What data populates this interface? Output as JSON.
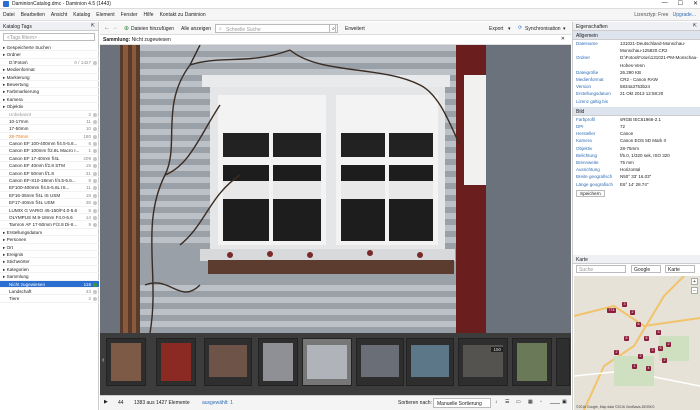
{
  "window": {
    "title": "DaminionCatalog.dmc - Daminion 4.5 (1443)",
    "controls": [
      "—",
      "☐",
      "✕"
    ]
  },
  "menu": {
    "items": [
      "Datei",
      "Bearbeiten",
      "Ansicht",
      "Katalog",
      "Element",
      "Fenster",
      "Hilfe",
      "Kontakt zu Daminion"
    ],
    "license": "Lizenztyp: Free",
    "upgrade": "Upgrade..."
  },
  "left": {
    "header": "Katalog Tags",
    "filter_placeholder": "<Tags filtern>",
    "tree": [
      {
        "label": "Gespeicherte Suchen",
        "level": 0
      },
      {
        "label": "Ordner",
        "level": 0
      },
      {
        "label": "D:\\Fotos\\",
        "level": 1,
        "count": "0 / 1427"
      },
      {
        "label": "Medienformat",
        "level": 0
      },
      {
        "label": "Markierung",
        "level": 0
      },
      {
        "label": "Bewertung",
        "level": 0
      },
      {
        "label": "Farbmarkierung",
        "level": 0
      },
      {
        "label": "Kamera",
        "level": 0
      },
      {
        "label": "Objektiv",
        "level": 0
      },
      {
        "label": "Unbekannt",
        "level": 1,
        "count": "2",
        "muted": true
      },
      {
        "label": "10-17mm",
        "level": 1,
        "count": "11"
      },
      {
        "label": "17-50mm",
        "level": 1,
        "count": "10"
      },
      {
        "label": "28-75mm",
        "level": 1,
        "count": "180",
        "orange": true
      },
      {
        "label": "Canon EF 100-400mm f/4.5-5.6...",
        "level": 1,
        "count": "6"
      },
      {
        "label": "Canon EF 100mm f/2.8L Macro I...",
        "level": 1,
        "count": "1"
      },
      {
        "label": "Canon EF 17-40mm f/4L",
        "level": 1,
        "count": "209"
      },
      {
        "label": "Canon EF 40mm f/2.8 STM",
        "level": 1,
        "count": "19"
      },
      {
        "label": "Canon EF 50mm f/1.8",
        "level": 1,
        "count": "31"
      },
      {
        "label": "Canon EF-S10-18mm f/4.5-5.6...",
        "level": 1,
        "count": "8"
      },
      {
        "label": "EF100-400mm f/4.5-5.6L IS...",
        "level": 1,
        "count": "11"
      },
      {
        "label": "EF16-35mm f/4L IS USM",
        "level": 1,
        "count": "18"
      },
      {
        "label": "EF17-40mm f/4L USM",
        "level": 1,
        "count": "38"
      },
      {
        "label": "LUMIX G VARIO 45-150/F4.0-5.6",
        "level": 1,
        "count": "8"
      },
      {
        "label": "OLYMPUS M.9-18mm F4.0-5.6",
        "level": 1,
        "count": "14"
      },
      {
        "label": "Tamron AF 17-50mm F/2.8 Di-II...",
        "level": 1,
        "count": "9"
      },
      {
        "label": "Erstellungsdatum",
        "level": 0
      },
      {
        "label": "Personen",
        "level": 0
      },
      {
        "label": "Ort",
        "level": 0
      },
      {
        "label": "Ereignis",
        "level": 0
      },
      {
        "label": "Stichwörter",
        "level": 0
      },
      {
        "label": "Kategorien",
        "level": 0
      },
      {
        "label": "Sammlung",
        "level": 0
      },
      {
        "label": "Nicht zugewiesen",
        "level": 1,
        "count": "116",
        "selected": true
      },
      {
        "label": "Landschaft",
        "level": 1,
        "count": "43"
      },
      {
        "label": "Tiere",
        "level": 1,
        "count": "2"
      }
    ]
  },
  "toolbar": {
    "add_files": "Dateien hinzufügen",
    "show_all": "Alle anzeigen",
    "search_placeholder": "Schnelle Suche",
    "advanced": "Erweitert",
    "export": "Export",
    "sync": "Synchronisation"
  },
  "subbar": {
    "label": "Sammlung:",
    "value": "Nicht zugewiesen"
  },
  "filmstrip": {
    "badge": "150"
  },
  "status": {
    "page": "44",
    "count": "1383 aus 1427 Elemente",
    "selected": "ausgewählt: 1",
    "sort_label": "Sortieren nach:",
    "sort_value": "Manuelle Sortierung"
  },
  "props": {
    "header": "Eigenschaften",
    "group1": "Allgemein",
    "items": [
      {
        "k": "Dateiname",
        "v": "131021-Deutschland-Monschau-Monschau-125820.CR2"
      },
      {
        "k": "Ordner",
        "v": "D:\\Fotos\\Fotos\\131021-PM-Monschau-Hohes-Venn"
      },
      {
        "k": "Dateigröße",
        "v": "26.290 KB"
      },
      {
        "k": "Medienformat",
        "v": "CR2 - Canon RAW"
      },
      {
        "k": "Version",
        "v": "5834a3753b24"
      },
      {
        "k": "Erstellungsdatum",
        "v": "21 Okt 2013   12:58:20"
      },
      {
        "k": "Lizenz gültig bis",
        "v": ""
      }
    ],
    "group2": "Bild",
    "items2": [
      {
        "k": "Farbprofil",
        "v": "sRGB IEC61966-2.1"
      },
      {
        "k": "DPI",
        "v": "72"
      },
      {
        "k": "Hersteller",
        "v": "Canon"
      },
      {
        "k": "Kamera",
        "v": "Canon EOS 5D Mark II"
      },
      {
        "k": "Objektiv",
        "v": "28-75mm"
      },
      {
        "k": "Belichtung",
        "v": "f/5.0, 1/320 sek, ISO 320"
      },
      {
        "k": "Brennweite",
        "v": "75 mm"
      },
      {
        "k": "Ausrichtung",
        "v": "Horizontal"
      },
      {
        "k": "Breite geografisch",
        "v": "N50° 33' 16.03\""
      },
      {
        "k": "Länge geografisch",
        "v": "E6° 14' 28.74\""
      }
    ],
    "save": "Speichern"
  },
  "map": {
    "header": "Karte",
    "search_placeholder": "Suche",
    "provider": "Google",
    "type": "Karte",
    "pins": [
      "774",
      "3",
      "2",
      "6",
      "5",
      "3",
      "2",
      "1",
      "4",
      "6",
      "2",
      "3",
      "5",
      "2",
      "2"
    ],
    "copyright": "©2016 Google, Map data ©2016 GeoBasis-DE/BKG"
  }
}
